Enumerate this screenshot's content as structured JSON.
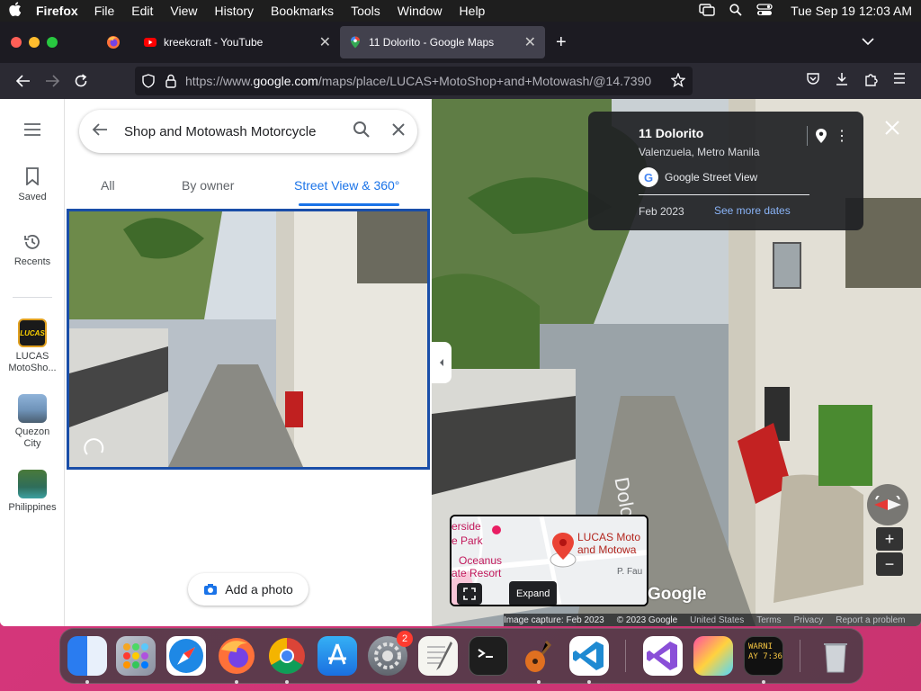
{
  "menubar": {
    "app_name": "Firefox",
    "items": [
      "File",
      "Edit",
      "View",
      "History",
      "Bookmarks",
      "Tools",
      "Window",
      "Help"
    ],
    "clock": "Tue Sep 19  12:03 AM"
  },
  "browser": {
    "tabs": [
      {
        "label": "kreekcraft - YouTube"
      },
      {
        "label": "11 Dolorito - Google Maps"
      }
    ],
    "url_prefix": "https://www.",
    "url_domain": "google.com",
    "url_path": "/maps/place/LUCAS+MotoShop+and+Motowash/@14.7390"
  },
  "rail": {
    "saved": "Saved",
    "recents": "Recents",
    "recent_places": [
      {
        "label": "LUCAS MotoSho...",
        "thumb_text": "LUCAS"
      },
      {
        "label": "Quezon City"
      },
      {
        "label": "Philippines"
      }
    ]
  },
  "panel": {
    "search_value": "Shop and Motowash Motorcycle",
    "filters": [
      "All",
      "By owner",
      "Street View & 360°"
    ],
    "active_filter": "Street View & 360°",
    "add_photo": "Add a photo"
  },
  "streetview": {
    "title": "11 Dolorito",
    "subtitle": "Valenzuela, Metro Manila",
    "source": "Google Street View",
    "date": "Feb 2023",
    "see_more": "See more dates",
    "street_label": "Dolorito",
    "minimap": {
      "labels": [
        "erside",
        "e Park",
        "Oceanus",
        "ate Resort",
        "LUCAS Moto",
        "and Motowa",
        "P. Fau"
      ],
      "expand": "Expand"
    },
    "google_mark": "Google",
    "footer": [
      "Image capture: Feb 2023",
      "© 2023 Google",
      "United States",
      "Terms",
      "Privacy",
      "Report a problem"
    ]
  },
  "dock": {
    "badge_count": "2",
    "terminal_text": "WARNI\nAY 7:36"
  },
  "colors": {
    "accent": "#1a73e8",
    "menubar": "#1e1e1e",
    "tabbar": "#1c1b22",
    "navbar": "#2b2a33",
    "desktop": "#d4367a"
  }
}
